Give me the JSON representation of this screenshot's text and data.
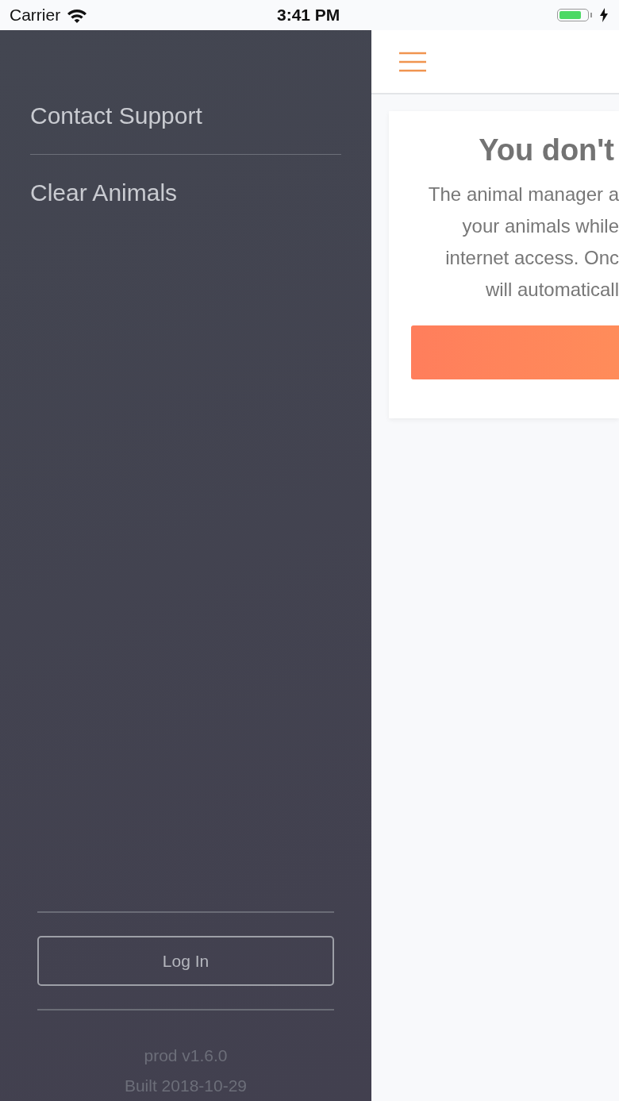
{
  "status_bar": {
    "carrier": "Carrier",
    "time": "3:41 PM",
    "charging": true,
    "battery": {
      "level": 0.8
    }
  },
  "sidebar": {
    "items": [
      {
        "label": "Contact Support"
      },
      {
        "label": "Clear Animals"
      }
    ],
    "login_button": "Log In",
    "version": "prod v1.6.0",
    "build": "Built 2018-10-29"
  },
  "main": {
    "card": {
      "title": "You don't",
      "message_lines": [
        "The animal manager a",
        "your animals while",
        "internet access. Onc",
        "will automaticall"
      ]
    }
  }
}
